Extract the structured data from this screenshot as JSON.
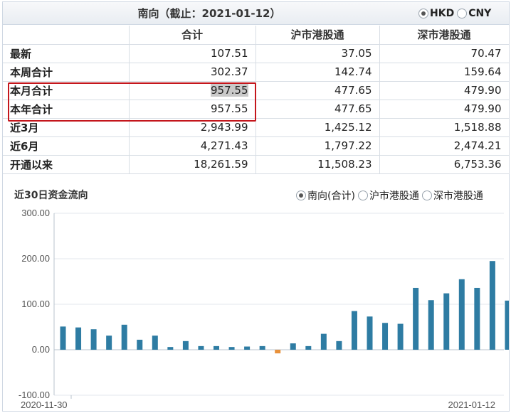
{
  "header": {
    "title": "南向（截止：2021-01-12）",
    "currency_options": [
      {
        "label": "HKD",
        "checked": true
      },
      {
        "label": "CNY",
        "checked": false
      }
    ]
  },
  "table": {
    "columns": [
      "",
      "合计",
      "沪市港股通",
      "深市港股通"
    ],
    "rows": [
      {
        "label": "最新",
        "values": [
          "107.51",
          "37.05",
          "70.47"
        ]
      },
      {
        "label": "本周合计",
        "values": [
          "302.37",
          "142.74",
          "159.64"
        ]
      },
      {
        "label": "本月合计",
        "values": [
          "957.55",
          "477.65",
          "479.90"
        ]
      },
      {
        "label": "本年合计",
        "values": [
          "957.55",
          "477.65",
          "479.90"
        ]
      },
      {
        "label": "近3月",
        "values": [
          "2,943.99",
          "1,425.12",
          "1,518.88"
        ]
      },
      {
        "label": "近6月",
        "values": [
          "4,271.43",
          "1,797.22",
          "2,474.21"
        ]
      },
      {
        "label": "开通以来",
        "values": [
          "18,261.59",
          "11,508.23",
          "6,753.36"
        ]
      }
    ]
  },
  "chart_section": {
    "title": "近30日资金流向",
    "series_options": [
      {
        "label": "南向(合计)",
        "checked": true
      },
      {
        "label": "沪市港股通",
        "checked": false
      },
      {
        "label": "深市港股通",
        "checked": false
      }
    ]
  },
  "chart_data": {
    "type": "bar",
    "title": "近30日资金流向",
    "xlabel": "",
    "ylabel": "",
    "ylim": [
      -100,
      300
    ],
    "yticks": [
      "300.00",
      "200.00",
      "100.00",
      "0.00",
      "-100.00"
    ],
    "x_start_label": "2020-11-30",
    "x_end_label": "2021-01-12",
    "grid": true,
    "colors": {
      "positive": "#2e7ca3",
      "negative": "#e8913a",
      "grid": "#e3e7ec",
      "axis": "#b9c3cc"
    },
    "values": [
      51,
      49,
      45,
      31,
      55,
      22,
      31,
      6,
      19,
      8,
      8,
      6,
      7,
      8,
      -8,
      14,
      8,
      35,
      19,
      85,
      73,
      59,
      57,
      136,
      109,
      124,
      155,
      136,
      195,
      108
    ]
  }
}
